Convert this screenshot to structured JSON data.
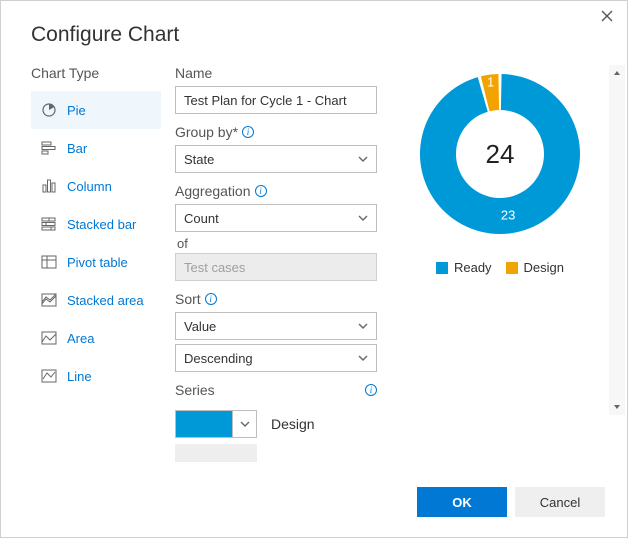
{
  "dialog": {
    "title": "Configure Chart"
  },
  "sidebar": {
    "label": "Chart Type",
    "items": [
      {
        "label": "Pie"
      },
      {
        "label": "Bar"
      },
      {
        "label": "Column"
      },
      {
        "label": "Stacked bar"
      },
      {
        "label": "Pivot table"
      },
      {
        "label": "Stacked area"
      },
      {
        "label": "Area"
      },
      {
        "label": "Line"
      }
    ],
    "selected_index": 0
  },
  "form": {
    "name_label": "Name",
    "name_value": "Test Plan for Cycle 1 - Chart",
    "group_by_label": "Group by*",
    "group_by_value": "State",
    "aggregation_label": "Aggregation",
    "aggregation_value": "Count",
    "of_label": "of",
    "of_value": "Test cases",
    "sort_label": "Sort",
    "sort_field": "Value",
    "sort_order": "Descending",
    "series_label": "Series",
    "series": [
      {
        "color": "#0099d8",
        "name": "Design"
      }
    ]
  },
  "chart_data": {
    "type": "pie",
    "style": "donut",
    "title": "",
    "total": 24,
    "categories": [
      "Ready",
      "Design"
    ],
    "values": [
      23,
      1
    ],
    "colors": [
      "#0099d8",
      "#f2a300"
    ],
    "data_labels": [
      "23",
      "1"
    ]
  },
  "legend": {
    "items": [
      {
        "label": "Ready"
      },
      {
        "label": "Design"
      }
    ]
  },
  "footer": {
    "ok": "OK",
    "cancel": "Cancel"
  }
}
